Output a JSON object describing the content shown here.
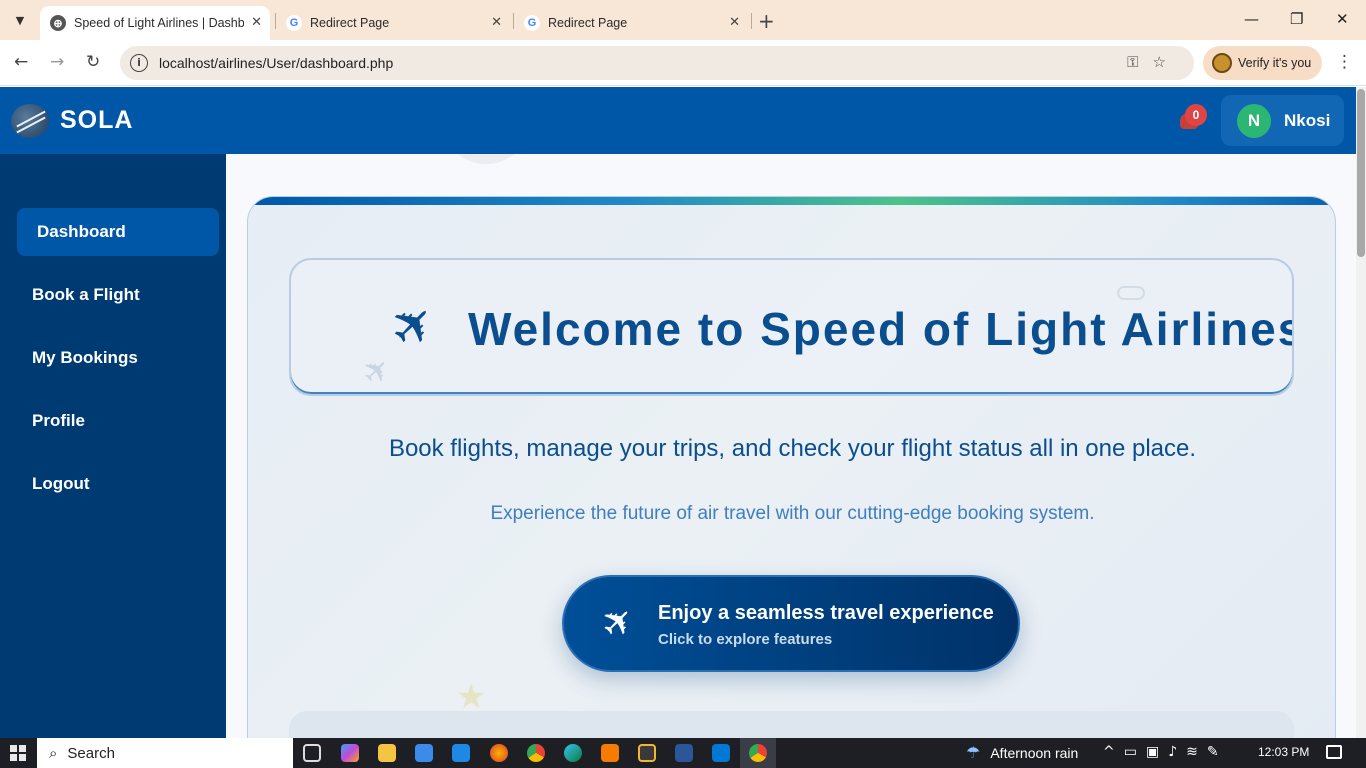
{
  "browser": {
    "tabs": [
      {
        "title": "Speed of Light Airlines | Dashbo",
        "active": true
      },
      {
        "title": "Redirect Page",
        "active": false
      },
      {
        "title": "Redirect Page",
        "active": false
      }
    ],
    "url_host": "localhost",
    "url_path": "/airlines/User/dashboard.php",
    "profile_label": "Verify it's you"
  },
  "header": {
    "logo_text": "SOLA",
    "notification_count": "0",
    "user_initial": "N",
    "user_name": "Nkosi"
  },
  "sidebar": {
    "items": [
      {
        "label": "Dashboard",
        "active": true
      },
      {
        "label": "Book a Flight",
        "active": false
      },
      {
        "label": "My Bookings",
        "active": false
      },
      {
        "label": "Profile",
        "active": false
      },
      {
        "label": "Logout",
        "active": false
      }
    ]
  },
  "main": {
    "welcome_title": "Welcome to Speed of Light Airlines",
    "headline": "Book flights, manage your trips, and check your flight status all in one place.",
    "subline": "Experience the future of air travel with our cutting-edge booking system.",
    "cta_title": "Enjoy a seamless travel experience",
    "cta_subtitle": "Click to explore features"
  },
  "taskbar": {
    "search_label": "Search",
    "weather": "Afternoon rain",
    "time": "12:03 PM"
  },
  "colors": {
    "header_blue": "#0057a8",
    "sidebar_navy": "#003a73",
    "accent_green": "#2bb673",
    "badge_red": "#e04545"
  }
}
